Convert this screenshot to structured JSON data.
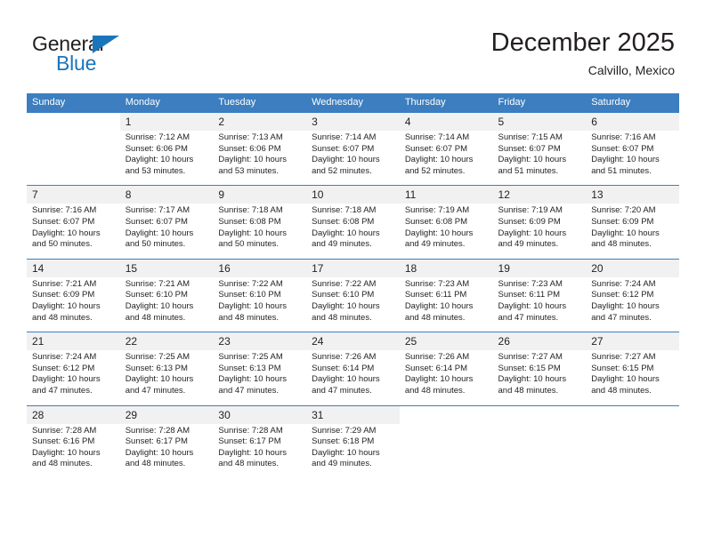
{
  "logo": {
    "word_top": "General",
    "word_bottom": "Blue",
    "triangle_icon": "triangle-icon",
    "brand_blue": "#1b75bb"
  },
  "header": {
    "title": "December 2025",
    "subtitle": "Calvillo, Mexico"
  },
  "colors": {
    "header_blue": "#3c7ebf",
    "daynum_band": "#f1f1f1",
    "text": "#231f20"
  },
  "weekdays": [
    "Sunday",
    "Monday",
    "Tuesday",
    "Wednesday",
    "Thursday",
    "Friday",
    "Saturday"
  ],
  "weeks": [
    [
      {
        "day": "",
        "lines": []
      },
      {
        "day": "1",
        "lines": [
          "Sunrise: 7:12 AM",
          "Sunset: 6:06 PM",
          "Daylight: 10 hours",
          "and 53 minutes."
        ]
      },
      {
        "day": "2",
        "lines": [
          "Sunrise: 7:13 AM",
          "Sunset: 6:06 PM",
          "Daylight: 10 hours",
          "and 53 minutes."
        ]
      },
      {
        "day": "3",
        "lines": [
          "Sunrise: 7:14 AM",
          "Sunset: 6:07 PM",
          "Daylight: 10 hours",
          "and 52 minutes."
        ]
      },
      {
        "day": "4",
        "lines": [
          "Sunrise: 7:14 AM",
          "Sunset: 6:07 PM",
          "Daylight: 10 hours",
          "and 52 minutes."
        ]
      },
      {
        "day": "5",
        "lines": [
          "Sunrise: 7:15 AM",
          "Sunset: 6:07 PM",
          "Daylight: 10 hours",
          "and 51 minutes."
        ]
      },
      {
        "day": "6",
        "lines": [
          "Sunrise: 7:16 AM",
          "Sunset: 6:07 PM",
          "Daylight: 10 hours",
          "and 51 minutes."
        ]
      }
    ],
    [
      {
        "day": "7",
        "lines": [
          "Sunrise: 7:16 AM",
          "Sunset: 6:07 PM",
          "Daylight: 10 hours",
          "and 50 minutes."
        ]
      },
      {
        "day": "8",
        "lines": [
          "Sunrise: 7:17 AM",
          "Sunset: 6:07 PM",
          "Daylight: 10 hours",
          "and 50 minutes."
        ]
      },
      {
        "day": "9",
        "lines": [
          "Sunrise: 7:18 AM",
          "Sunset: 6:08 PM",
          "Daylight: 10 hours",
          "and 50 minutes."
        ]
      },
      {
        "day": "10",
        "lines": [
          "Sunrise: 7:18 AM",
          "Sunset: 6:08 PM",
          "Daylight: 10 hours",
          "and 49 minutes."
        ]
      },
      {
        "day": "11",
        "lines": [
          "Sunrise: 7:19 AM",
          "Sunset: 6:08 PM",
          "Daylight: 10 hours",
          "and 49 minutes."
        ]
      },
      {
        "day": "12",
        "lines": [
          "Sunrise: 7:19 AM",
          "Sunset: 6:09 PM",
          "Daylight: 10 hours",
          "and 49 minutes."
        ]
      },
      {
        "day": "13",
        "lines": [
          "Sunrise: 7:20 AM",
          "Sunset: 6:09 PM",
          "Daylight: 10 hours",
          "and 48 minutes."
        ]
      }
    ],
    [
      {
        "day": "14",
        "lines": [
          "Sunrise: 7:21 AM",
          "Sunset: 6:09 PM",
          "Daylight: 10 hours",
          "and 48 minutes."
        ]
      },
      {
        "day": "15",
        "lines": [
          "Sunrise: 7:21 AM",
          "Sunset: 6:10 PM",
          "Daylight: 10 hours",
          "and 48 minutes."
        ]
      },
      {
        "day": "16",
        "lines": [
          "Sunrise: 7:22 AM",
          "Sunset: 6:10 PM",
          "Daylight: 10 hours",
          "and 48 minutes."
        ]
      },
      {
        "day": "17",
        "lines": [
          "Sunrise: 7:22 AM",
          "Sunset: 6:10 PM",
          "Daylight: 10 hours",
          "and 48 minutes."
        ]
      },
      {
        "day": "18",
        "lines": [
          "Sunrise: 7:23 AM",
          "Sunset: 6:11 PM",
          "Daylight: 10 hours",
          "and 48 minutes."
        ]
      },
      {
        "day": "19",
        "lines": [
          "Sunrise: 7:23 AM",
          "Sunset: 6:11 PM",
          "Daylight: 10 hours",
          "and 47 minutes."
        ]
      },
      {
        "day": "20",
        "lines": [
          "Sunrise: 7:24 AM",
          "Sunset: 6:12 PM",
          "Daylight: 10 hours",
          "and 47 minutes."
        ]
      }
    ],
    [
      {
        "day": "21",
        "lines": [
          "Sunrise: 7:24 AM",
          "Sunset: 6:12 PM",
          "Daylight: 10 hours",
          "and 47 minutes."
        ]
      },
      {
        "day": "22",
        "lines": [
          "Sunrise: 7:25 AM",
          "Sunset: 6:13 PM",
          "Daylight: 10 hours",
          "and 47 minutes."
        ]
      },
      {
        "day": "23",
        "lines": [
          "Sunrise: 7:25 AM",
          "Sunset: 6:13 PM",
          "Daylight: 10 hours",
          "and 47 minutes."
        ]
      },
      {
        "day": "24",
        "lines": [
          "Sunrise: 7:26 AM",
          "Sunset: 6:14 PM",
          "Daylight: 10 hours",
          "and 47 minutes."
        ]
      },
      {
        "day": "25",
        "lines": [
          "Sunrise: 7:26 AM",
          "Sunset: 6:14 PM",
          "Daylight: 10 hours",
          "and 48 minutes."
        ]
      },
      {
        "day": "26",
        "lines": [
          "Sunrise: 7:27 AM",
          "Sunset: 6:15 PM",
          "Daylight: 10 hours",
          "and 48 minutes."
        ]
      },
      {
        "day": "27",
        "lines": [
          "Sunrise: 7:27 AM",
          "Sunset: 6:15 PM",
          "Daylight: 10 hours",
          "and 48 minutes."
        ]
      }
    ],
    [
      {
        "day": "28",
        "lines": [
          "Sunrise: 7:28 AM",
          "Sunset: 6:16 PM",
          "Daylight: 10 hours",
          "and 48 minutes."
        ]
      },
      {
        "day": "29",
        "lines": [
          "Sunrise: 7:28 AM",
          "Sunset: 6:17 PM",
          "Daylight: 10 hours",
          "and 48 minutes."
        ]
      },
      {
        "day": "30",
        "lines": [
          "Sunrise: 7:28 AM",
          "Sunset: 6:17 PM",
          "Daylight: 10 hours",
          "and 48 minutes."
        ]
      },
      {
        "day": "31",
        "lines": [
          "Sunrise: 7:29 AM",
          "Sunset: 6:18 PM",
          "Daylight: 10 hours",
          "and 49 minutes."
        ]
      },
      {
        "day": "",
        "lines": []
      },
      {
        "day": "",
        "lines": []
      },
      {
        "day": "",
        "lines": []
      }
    ]
  ]
}
